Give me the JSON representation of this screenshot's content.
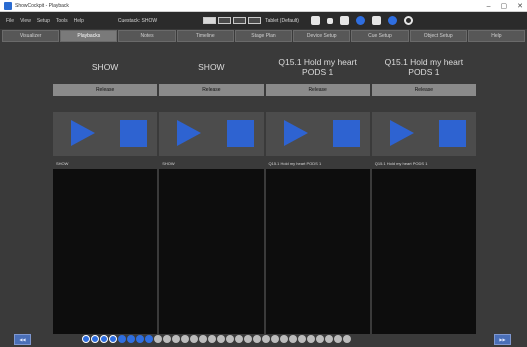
{
  "window": {
    "title": "ShowCockpit - Playback",
    "controls": [
      "–",
      "▢",
      "✕"
    ]
  },
  "menu": {
    "items": [
      "File",
      "View",
      "Setup",
      "Tools",
      "Help"
    ],
    "cue_info": "Cuestack: SHOW",
    "device": "Tablet (Default)"
  },
  "tabs": [
    {
      "label": "Visualizer",
      "active": false
    },
    {
      "label": "Playbacks",
      "active": true
    },
    {
      "label": "Notes",
      "active": false
    },
    {
      "label": "Timeline",
      "active": false
    },
    {
      "label": "Stage Plan",
      "active": false
    },
    {
      "label": "Device Setup",
      "active": false
    },
    {
      "label": "Cue Setup",
      "active": false
    },
    {
      "label": "Object Setup",
      "active": false
    },
    {
      "label": "Help",
      "active": false
    }
  ],
  "columns": [
    {
      "title": "SHOW",
      "release": "Release",
      "cue_name": "SHOW"
    },
    {
      "title": "SHOW",
      "release": "Release",
      "cue_name": "SHOW"
    },
    {
      "title": "Q15.1 Hold my heart PODS 1",
      "release": "Release",
      "cue_name": "Q15.1 Hold my heart PODS 1"
    },
    {
      "title": "Q15.1 Hold my heart PODS 1",
      "release": "Release",
      "cue_name": "Q15.1 Hold my heart PODS 1"
    }
  ],
  "nav": {
    "left": "◀◀",
    "right": "▶▶"
  },
  "pages": {
    "total": 30,
    "current": 1
  },
  "colors": {
    "accent": "#2e63d1",
    "background": "#3a3a3a",
    "panel": "#0d0d0d",
    "release": "#8a8a8a"
  }
}
